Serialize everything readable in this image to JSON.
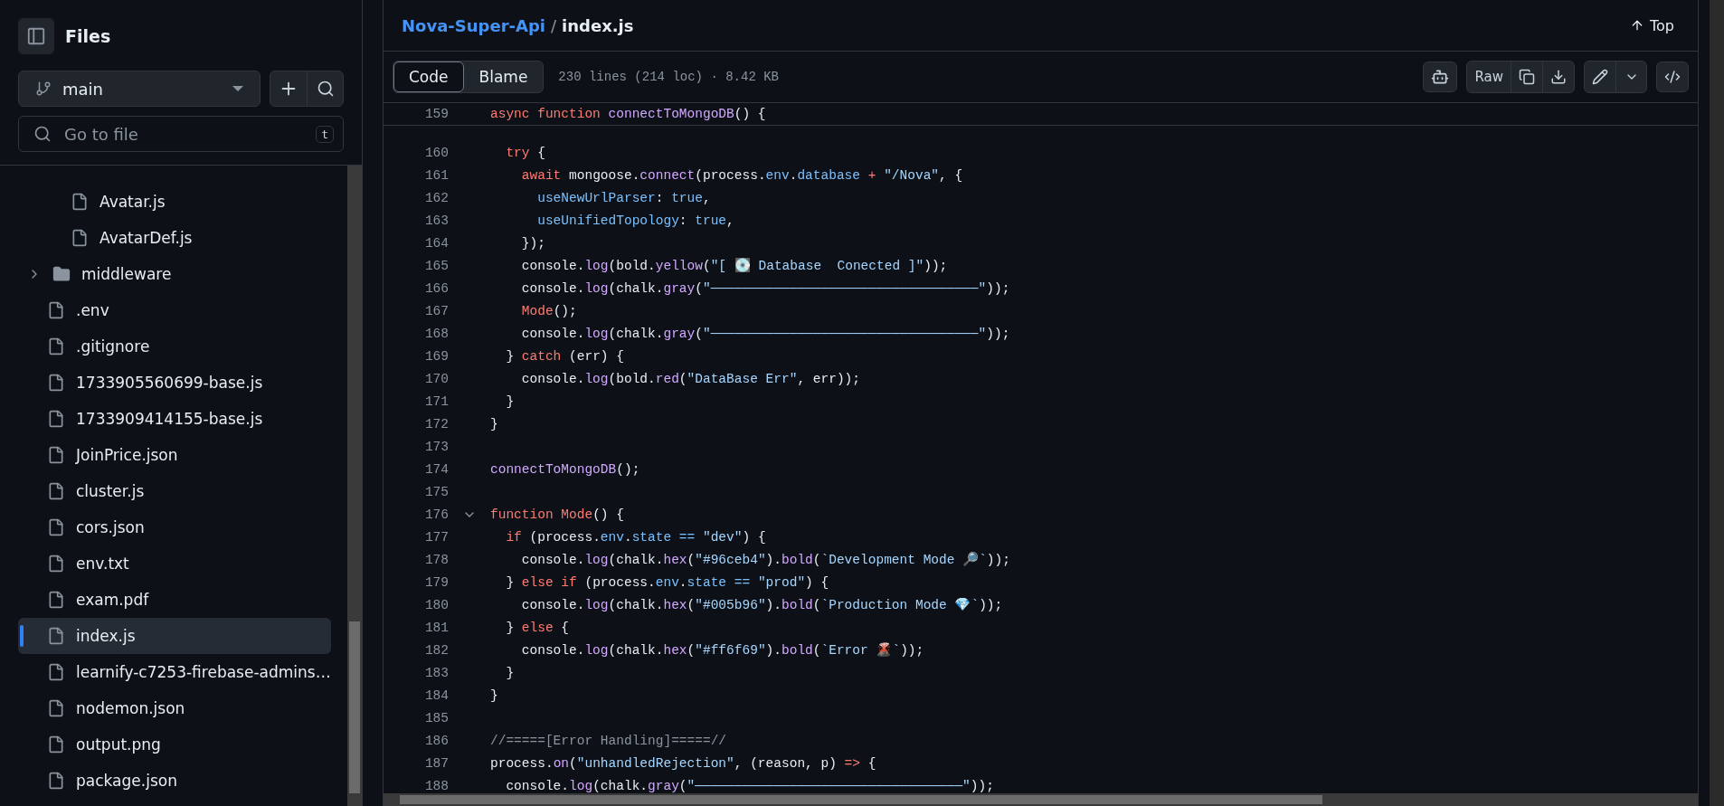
{
  "sidebar": {
    "title": "Files",
    "branch": "main",
    "search": {
      "placeholder": "Go to file",
      "shortcut": "t"
    },
    "tree": [
      {
        "kind": "hidden-folder",
        "children": [
          {
            "kind": "file",
            "name": "Avatar.js",
            "selected": false
          },
          {
            "kind": "file",
            "name": "AvatarDef.js",
            "selected": false
          }
        ]
      },
      {
        "kind": "folder",
        "name": "middleware",
        "expanded": false
      },
      {
        "kind": "file",
        "name": ".env",
        "selected": false
      },
      {
        "kind": "file",
        "name": ".gitignore",
        "selected": false
      },
      {
        "kind": "file",
        "name": "1733905560699-base.js",
        "selected": false
      },
      {
        "kind": "file",
        "name": "1733909414155-base.js",
        "selected": false
      },
      {
        "kind": "file",
        "name": "JoinPrice.json",
        "selected": false
      },
      {
        "kind": "file",
        "name": "cluster.js",
        "selected": false
      },
      {
        "kind": "file",
        "name": "cors.json",
        "selected": false
      },
      {
        "kind": "file",
        "name": "env.txt",
        "selected": false
      },
      {
        "kind": "file",
        "name": "exam.pdf",
        "selected": false
      },
      {
        "kind": "file",
        "name": "index.js",
        "selected": true
      },
      {
        "kind": "file",
        "name": "learnify-c7253-firebase-admins…",
        "selected": false
      },
      {
        "kind": "file",
        "name": "nodemon.json",
        "selected": false
      },
      {
        "kind": "file",
        "name": "output.png",
        "selected": false
      },
      {
        "kind": "file",
        "name": "package.json",
        "selected": false
      }
    ]
  },
  "breadcrumb": {
    "repo": "Nova-Super-Api",
    "separator": "/",
    "file": "index.js"
  },
  "top_button": "Top",
  "tabs": [
    {
      "label": "Code",
      "selected": true
    },
    {
      "label": "Blame",
      "selected": false
    }
  ],
  "file_info": "230 lines (214 loc) · 8.42 KB",
  "raw_button": "Raw",
  "sticky_line": {
    "n": "159",
    "tokens": [
      {
        "kind": "keyword",
        "text": "async function "
      },
      {
        "kind": "func",
        "text": "connectToMongoDB"
      },
      {
        "kind": "plain",
        "text": "() {"
      }
    ]
  },
  "lines": [
    {
      "n": "160",
      "fold": false,
      "tokens": [
        {
          "kind": "keyword",
          "text": "  try"
        },
        {
          "kind": "plain",
          "text": " {"
        }
      ]
    },
    {
      "n": "161",
      "fold": false,
      "tokens": [
        {
          "kind": "keyword",
          "text": "    await"
        },
        {
          "kind": "plain",
          "text": " mongoose."
        },
        {
          "kind": "func",
          "text": "connect"
        },
        {
          "kind": "plain",
          "text": "(process."
        },
        {
          "kind": "prop",
          "text": "env"
        },
        {
          "kind": "plain",
          "text": "."
        },
        {
          "kind": "prop",
          "text": "database"
        },
        {
          "kind": "keyword",
          "text": " + "
        },
        {
          "kind": "string",
          "text": "\"/Nova\""
        },
        {
          "kind": "plain",
          "text": ", {"
        }
      ]
    },
    {
      "n": "162",
      "fold": false,
      "tokens": [
        {
          "kind": "prop",
          "text": "      useNewUrlParser"
        },
        {
          "kind": "plain",
          "text": ": "
        },
        {
          "kind": "prop",
          "text": "true"
        },
        {
          "kind": "plain",
          "text": ","
        }
      ]
    },
    {
      "n": "163",
      "fold": false,
      "tokens": [
        {
          "kind": "prop",
          "text": "      useUnifiedTopology"
        },
        {
          "kind": "plain",
          "text": ": "
        },
        {
          "kind": "prop",
          "text": "true"
        },
        {
          "kind": "plain",
          "text": ","
        }
      ]
    },
    {
      "n": "164",
      "fold": false,
      "tokens": [
        {
          "kind": "plain",
          "text": "    });"
        }
      ]
    },
    {
      "n": "165",
      "fold": false,
      "tokens": [
        {
          "kind": "plain",
          "text": "    console."
        },
        {
          "kind": "func",
          "text": "log"
        },
        {
          "kind": "plain",
          "text": "(bold."
        },
        {
          "kind": "func",
          "text": "yellow"
        },
        {
          "kind": "plain",
          "text": "("
        },
        {
          "kind": "string",
          "text": "\"[ 💽 Database  Conected ]\""
        },
        {
          "kind": "plain",
          "text": "));"
        }
      ]
    },
    {
      "n": "166",
      "fold": false,
      "tokens": [
        {
          "kind": "plain",
          "text": "    console."
        },
        {
          "kind": "func",
          "text": "log"
        },
        {
          "kind": "plain",
          "text": "(chalk."
        },
        {
          "kind": "func",
          "text": "gray"
        },
        {
          "kind": "plain",
          "text": "("
        },
        {
          "kind": "string",
          "text": "\"──────────────────────────────────\""
        },
        {
          "kind": "plain",
          "text": "));"
        }
      ]
    },
    {
      "n": "167",
      "fold": false,
      "tokens": [
        {
          "kind": "keyword",
          "text": "    Mode"
        },
        {
          "kind": "plain",
          "text": "();"
        }
      ]
    },
    {
      "n": "168",
      "fold": false,
      "tokens": [
        {
          "kind": "plain",
          "text": "    console."
        },
        {
          "kind": "func",
          "text": "log"
        },
        {
          "kind": "plain",
          "text": "(chalk."
        },
        {
          "kind": "func",
          "text": "gray"
        },
        {
          "kind": "plain",
          "text": "("
        },
        {
          "kind": "string",
          "text": "\"──────────────────────────────────\""
        },
        {
          "kind": "plain",
          "text": "));"
        }
      ]
    },
    {
      "n": "169",
      "fold": false,
      "tokens": [
        {
          "kind": "plain",
          "text": "  } "
        },
        {
          "kind": "keyword",
          "text": "catch"
        },
        {
          "kind": "plain",
          "text": " (err) {"
        }
      ]
    },
    {
      "n": "170",
      "fold": false,
      "tokens": [
        {
          "kind": "plain",
          "text": "    console."
        },
        {
          "kind": "func",
          "text": "log"
        },
        {
          "kind": "plain",
          "text": "(bold."
        },
        {
          "kind": "func",
          "text": "red"
        },
        {
          "kind": "plain",
          "text": "("
        },
        {
          "kind": "string",
          "text": "\"DataBase Err\""
        },
        {
          "kind": "plain",
          "text": ", err));"
        }
      ]
    },
    {
      "n": "171",
      "fold": false,
      "tokens": [
        {
          "kind": "plain",
          "text": "  }"
        }
      ]
    },
    {
      "n": "172",
      "fold": false,
      "tokens": [
        {
          "kind": "plain",
          "text": "}"
        }
      ]
    },
    {
      "n": "173",
      "fold": false
    },
    {
      "n": "174",
      "fold": false,
      "tokens": [
        {
          "kind": "func",
          "text": "connectToMongoDB"
        },
        {
          "kind": "plain",
          "text": "();"
        }
      ]
    },
    {
      "n": "175",
      "fold": false
    },
    {
      "n": "176",
      "fold": true,
      "tokens": [
        {
          "kind": "keyword",
          "text": "function Mode"
        },
        {
          "kind": "plain",
          "text": "() {"
        }
      ]
    },
    {
      "n": "177",
      "fold": false,
      "tokens": [
        {
          "kind": "keyword",
          "text": "  if"
        },
        {
          "kind": "plain",
          "text": " (process."
        },
        {
          "kind": "prop",
          "text": "env"
        },
        {
          "kind": "plain",
          "text": "."
        },
        {
          "kind": "prop",
          "text": "state"
        },
        {
          "kind": "prop",
          "text": " == "
        },
        {
          "kind": "string",
          "text": "\"dev\""
        },
        {
          "kind": "plain",
          "text": ") {"
        }
      ]
    },
    {
      "n": "178",
      "fold": false,
      "tokens": [
        {
          "kind": "plain",
          "text": "    console."
        },
        {
          "kind": "func",
          "text": "log"
        },
        {
          "kind": "plain",
          "text": "(chalk."
        },
        {
          "kind": "func",
          "text": "hex"
        },
        {
          "kind": "plain",
          "text": "("
        },
        {
          "kind": "string",
          "text": "\"#96ceb4\""
        },
        {
          "kind": "plain",
          "text": ")."
        },
        {
          "kind": "func",
          "text": "bold"
        },
        {
          "kind": "plain",
          "text": "("
        },
        {
          "kind": "string",
          "text": "`Development Mode 🔎`"
        },
        {
          "kind": "plain",
          "text": "));"
        }
      ]
    },
    {
      "n": "179",
      "fold": false,
      "tokens": [
        {
          "kind": "plain",
          "text": "  } "
        },
        {
          "kind": "keyword",
          "text": "else if"
        },
        {
          "kind": "plain",
          "text": " (process."
        },
        {
          "kind": "prop",
          "text": "env"
        },
        {
          "kind": "plain",
          "text": "."
        },
        {
          "kind": "prop",
          "text": "state"
        },
        {
          "kind": "prop",
          "text": " == "
        },
        {
          "kind": "string",
          "text": "\"prod\""
        },
        {
          "kind": "plain",
          "text": ") {"
        }
      ]
    },
    {
      "n": "180",
      "fold": false,
      "tokens": [
        {
          "kind": "plain",
          "text": "    console."
        },
        {
          "kind": "func",
          "text": "log"
        },
        {
          "kind": "plain",
          "text": "(chalk."
        },
        {
          "kind": "func",
          "text": "hex"
        },
        {
          "kind": "plain",
          "text": "("
        },
        {
          "kind": "string",
          "text": "\"#005b96\""
        },
        {
          "kind": "plain",
          "text": ")."
        },
        {
          "kind": "func",
          "text": "bold"
        },
        {
          "kind": "plain",
          "text": "("
        },
        {
          "kind": "string",
          "text": "`Production Mode 💎`"
        },
        {
          "kind": "plain",
          "text": "));"
        }
      ]
    },
    {
      "n": "181",
      "fold": false,
      "tokens": [
        {
          "kind": "plain",
          "text": "  } "
        },
        {
          "kind": "keyword",
          "text": "else"
        },
        {
          "kind": "plain",
          "text": " {"
        }
      ]
    },
    {
      "n": "182",
      "fold": false,
      "tokens": [
        {
          "kind": "plain",
          "text": "    console."
        },
        {
          "kind": "func",
          "text": "log"
        },
        {
          "kind": "plain",
          "text": "(chalk."
        },
        {
          "kind": "func",
          "text": "hex"
        },
        {
          "kind": "plain",
          "text": "("
        },
        {
          "kind": "string",
          "text": "\"#ff6f69\""
        },
        {
          "kind": "plain",
          "text": ")."
        },
        {
          "kind": "func",
          "text": "bold"
        },
        {
          "kind": "plain",
          "text": "("
        },
        {
          "kind": "string",
          "text": "`Error 🌋`"
        },
        {
          "kind": "plain",
          "text": "));"
        }
      ]
    },
    {
      "n": "183",
      "fold": false,
      "tokens": [
        {
          "kind": "plain",
          "text": "  }"
        }
      ]
    },
    {
      "n": "184",
      "fold": false,
      "tokens": [
        {
          "kind": "plain",
          "text": "}"
        }
      ]
    },
    {
      "n": "185",
      "fold": false
    },
    {
      "n": "186",
      "fold": false,
      "tokens": [
        {
          "kind": "comment",
          "text": "//=====[Error Handling]=====//"
        }
      ]
    },
    {
      "n": "187",
      "fold": false,
      "tokens": [
        {
          "kind": "plain",
          "text": "process."
        },
        {
          "kind": "func",
          "text": "on"
        },
        {
          "kind": "plain",
          "text": "("
        },
        {
          "kind": "string",
          "text": "\"unhandledRejection\""
        },
        {
          "kind": "plain",
          "text": ", (reason, p) "
        },
        {
          "kind": "keyword",
          "text": "=>"
        },
        {
          "kind": "plain",
          "text": " {"
        }
      ]
    },
    {
      "n": "188",
      "fold": false,
      "tokens": [
        {
          "kind": "plain",
          "text": "  console."
        },
        {
          "kind": "func",
          "text": "log"
        },
        {
          "kind": "plain",
          "text": "(chalk."
        },
        {
          "kind": "func",
          "text": "gray"
        },
        {
          "kind": "plain",
          "text": "("
        },
        {
          "kind": "string",
          "text": "\"──────────────────────────────────\""
        },
        {
          "kind": "plain",
          "text": "));"
        }
      ]
    }
  ]
}
